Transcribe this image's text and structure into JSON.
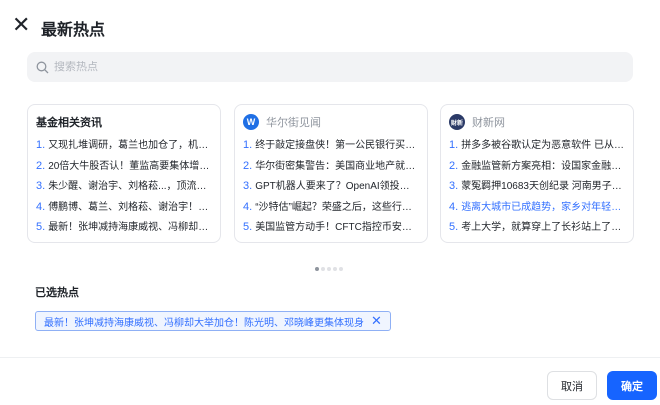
{
  "header": {
    "title": "最新热点",
    "close_icon": "close-icon"
  },
  "search": {
    "placeholder": "搜索热点",
    "value": ""
  },
  "cards": [
    {
      "title": "基金相关资讯",
      "items": [
        "又现扎堆调研，葛兰也加仓了，机构...",
        "20倍大牛股否认！董监高要集体增持...",
        "朱少醒、谢治宇、刘格菘...，顶流最...",
        "傅鹏博、葛兰、刘格菘、谢治宇！四...",
        "最新！张坤减持海康威视、冯柳却大..."
      ]
    },
    {
      "title": "华尔街见闻",
      "logo": "W",
      "logo_color": "#1f6fe5",
      "items": [
        "终于敲定接盘侠！第一公民银行买下...",
        "华尔街密集警告：美国商业地产就是...",
        "GPT机器人要来了？OpenAI领投挪威...",
        "“沙特估”崛起？荣盛之后，这些行业...",
        "美国监管方动手！CFTC指控币安和..."
      ]
    },
    {
      "title": "财新网",
      "logo": "财新",
      "logo_color": "#2b3a67",
      "items": [
        "拼多多被谷歌认定为恶意软件 已从谷...",
        "金融监管新方案亮相：设国家金融监...",
        "蒙冤羁押10683天创纪录 河南男子谭...",
        "逃离大城市已成趋势，家乡对年轻人...",
        "考上大学，就算穿上了长衫站上了高..."
      ]
    }
  ],
  "pagination": {
    "total": 5,
    "current": 1
  },
  "selected": {
    "title": "已选热点",
    "tags": [
      "最新！张坤减持海康威视、冯柳却大举加仓！陈光明、邓晓峰更集体现身"
    ]
  },
  "footer": {
    "cancel": "取消",
    "confirm": "确定"
  },
  "colors": {
    "accent": "#1664ff",
    "link": "#3370ff"
  }
}
